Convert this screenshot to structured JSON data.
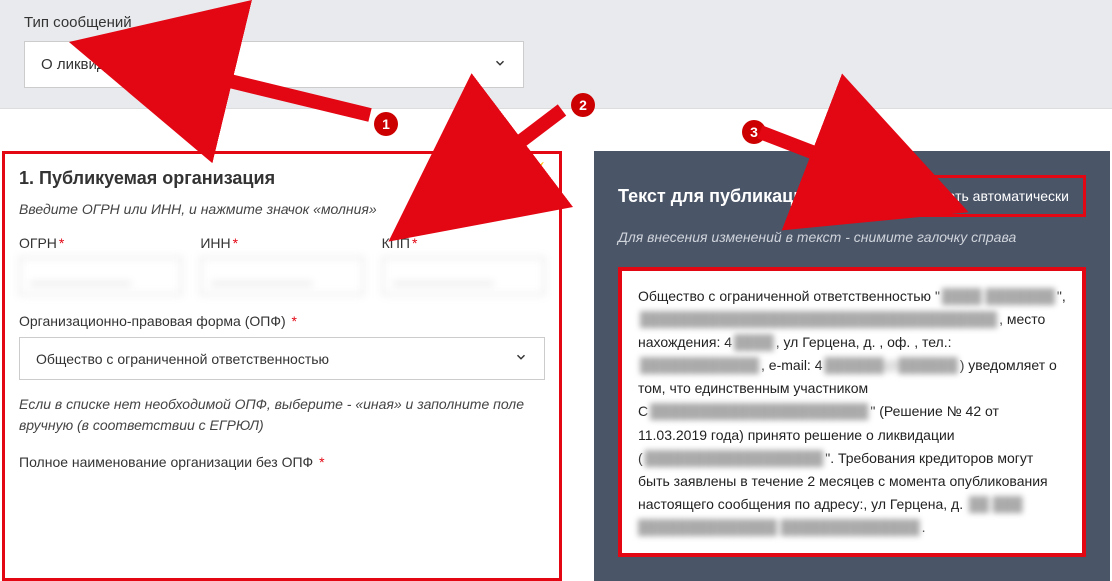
{
  "top": {
    "label": "Тип сообщений",
    "value": "О ликвидации ЮЛ"
  },
  "left": {
    "title": "1. Публикуемая организация",
    "bolt": "⚡",
    "hint": "Введите ОГРН или ИНН, и нажмите значок «молния»",
    "ogrn_label": "ОГРН",
    "inn_label": "ИНН",
    "kpp_label": "КПП",
    "ogrn_value": "_____________",
    "inn_value": "_____________",
    "kpp_value": "_____________",
    "opf_label": "Организационно-правовая форма (ОПФ)",
    "opf_value": "Общество с ограниченной ответственностью",
    "opf_hint": "Если в списке нет необходимой ОПФ, выберите - «иная» и заполните поле вручную (в соответствии с ЕГРЮЛ)",
    "fullname_label": "Полное наименование организации без ОПФ"
  },
  "right": {
    "title": "Текст для публикации",
    "auto_label": "Формировать автоматически",
    "hint": "Для внесения изменений в текст - снимите галочку справа",
    "preview_prefix": "Общество с ограниченной ответственностью \"",
    "preview_line2a": "\", ",
    "preview_line3a": "место нахождения: 4",
    "preview_line3b": ", ул Герцена, д.  , оф.    , тел.: ",
    "preview_line4a": ", e-mail: 4",
    "preview_line4b": ") уведомляет о том, что единственным участником С",
    "preview_line5a": "\" (Решение № 42 от 11.03.2019 года) принято решение о ликвидации (",
    "preview_line5b": "\". Требования кредиторов могут быть заявлены в течение 2 месяцев с момента опубликования настоящего сообщения по адресу:, ул Герцена, д. ",
    "preview_line6": "."
  },
  "annots": {
    "n1": "1",
    "n2": "2",
    "n3": "3"
  }
}
